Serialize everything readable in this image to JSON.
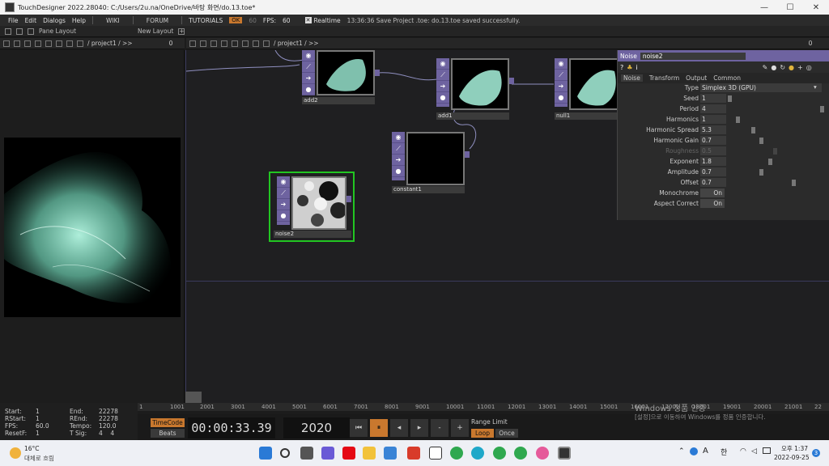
{
  "titlebar": {
    "title": "TouchDesigner 2022.28040: C:/Users/2u.na/OneDrive/바탕 화면/do.13.toe*",
    "minimize": "—",
    "maximize": "☐",
    "close": "✕"
  },
  "menubar": {
    "items": [
      "File",
      "Edit",
      "Dialogs",
      "Help"
    ],
    "wiki": "WIKI",
    "forum": "FORUM",
    "tutorials": "TUTORIALS",
    "ok": "OK",
    "ok_num": "60",
    "fps_label": "FPS:",
    "fps_value": "60",
    "realtime": "Realtime",
    "message": "13:36:36 Save Project .toe: do.13.toe saved successfully."
  },
  "panebar": {
    "pane_layout": "Pane Layout",
    "new_layout": "New Layout",
    "plus": "+"
  },
  "left_path": {
    "path": "/ project1 / >>",
    "zero": "0"
  },
  "right_path": {
    "path": "/ project1 / >>",
    "zero": "0"
  },
  "nodes": {
    "add2": "add2",
    "add1": "add1",
    "null1": "null1",
    "constant1": "constant1",
    "noise2": "noise2"
  },
  "params": {
    "op_type": "Noise",
    "op_name": "noise2",
    "tabs": [
      "Noise",
      "Transform",
      "Output",
      "Common"
    ],
    "rows": [
      {
        "label": "Type",
        "value": "Simplex 3D (GPU)"
      },
      {
        "label": "Seed",
        "value": "1"
      },
      {
        "label": "Period",
        "value": "4"
      },
      {
        "label": "Harmonics",
        "value": "1"
      },
      {
        "label": "Harmonic Spread",
        "value": "5.3"
      },
      {
        "label": "Harmonic Gain",
        "value": "0.7"
      },
      {
        "label": "Roughness",
        "value": "0.5"
      },
      {
        "label": "Exponent",
        "value": "1.8"
      },
      {
        "label": "Amplitude",
        "value": "0.7"
      },
      {
        "label": "Offset",
        "value": "0.7"
      },
      {
        "label": "Monochrome",
        "value": "On"
      },
      {
        "label": "Aspect Correct",
        "value": "On"
      }
    ]
  },
  "timeline": {
    "ticks": [
      "1",
      "1001",
      "2001",
      "3001",
      "4001",
      "5001",
      "6001",
      "7001",
      "8001",
      "9001",
      "10001",
      "11001",
      "12001",
      "13001",
      "14001",
      "15001",
      "16001",
      "17001",
      "18001",
      "19001",
      "20001",
      "21001",
      "22"
    ]
  },
  "info": {
    "start_l": "Start:",
    "start_v": "1",
    "end_l": "End:",
    "end_v": "22278",
    "rstart_l": "RStart:",
    "rstart_v": "1",
    "rend_l": "REnd:",
    "rend_v": "22278",
    "fps_l": "FPS:",
    "fps_v": "60.0",
    "tempo_l": "Tempo:",
    "tempo_v": "120.0",
    "resetf_l": "ResetF:",
    "resetf_v": "1",
    "tsig_l": "T Sig:",
    "tsig_v1": "4",
    "tsig_v2": "4"
  },
  "transport": {
    "timecode": "TimeCode",
    "beats": "Beats",
    "time": "00:00:33.39",
    "frame": "2020",
    "range_limit": "Range Limit",
    "loop": "Loop",
    "once": "Once"
  },
  "watermark": {
    "line1": "Windows 정품 인증",
    "line2": "[설정]으로 이동하여 Windows를 정품 인증합니다."
  },
  "taskbar": {
    "temp": "16°C",
    "weather": "대체로 흐림",
    "lang": "A",
    "ime": "한",
    "ampm": "오후 1:37",
    "date": "2022-09-25",
    "notif": "3"
  },
  "colors": {
    "operator": "#6e63a0",
    "selected": "#22c622",
    "accent": "#c9782e"
  }
}
